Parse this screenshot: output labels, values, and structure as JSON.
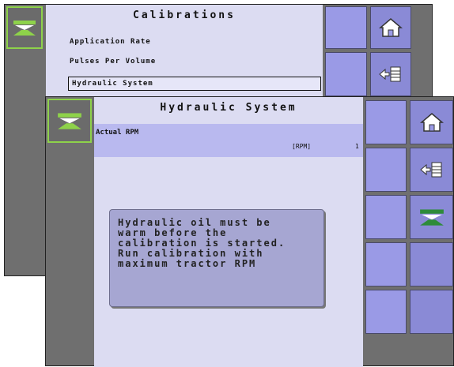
{
  "back_screen": {
    "title": "Calibrations",
    "items": [
      {
        "label": "Application Rate"
      },
      {
        "label": "Pulses Per Volume"
      },
      {
        "label": "Hydraulic System"
      }
    ],
    "nav": {
      "home": "home-icon",
      "back": "back-icon"
    }
  },
  "front_screen": {
    "title": "Hydraulic System",
    "field": {
      "label": "Actual RPM",
      "unit": "[RPM]",
      "value": "1"
    },
    "message": [
      "Hydraulic oil must be",
      "warm before the",
      "calibration is started.",
      "Run calibration with",
      "maximum tractor RPM"
    ],
    "nav": {
      "home": "home-icon",
      "back": "back-icon",
      "spread": "spread-icon"
    }
  },
  "colors": {
    "accent_green": "#8ed24a",
    "key_blue": "#9a9ae6",
    "content_bg": "#dcdcf2",
    "highlight": "#b9b9ef"
  }
}
